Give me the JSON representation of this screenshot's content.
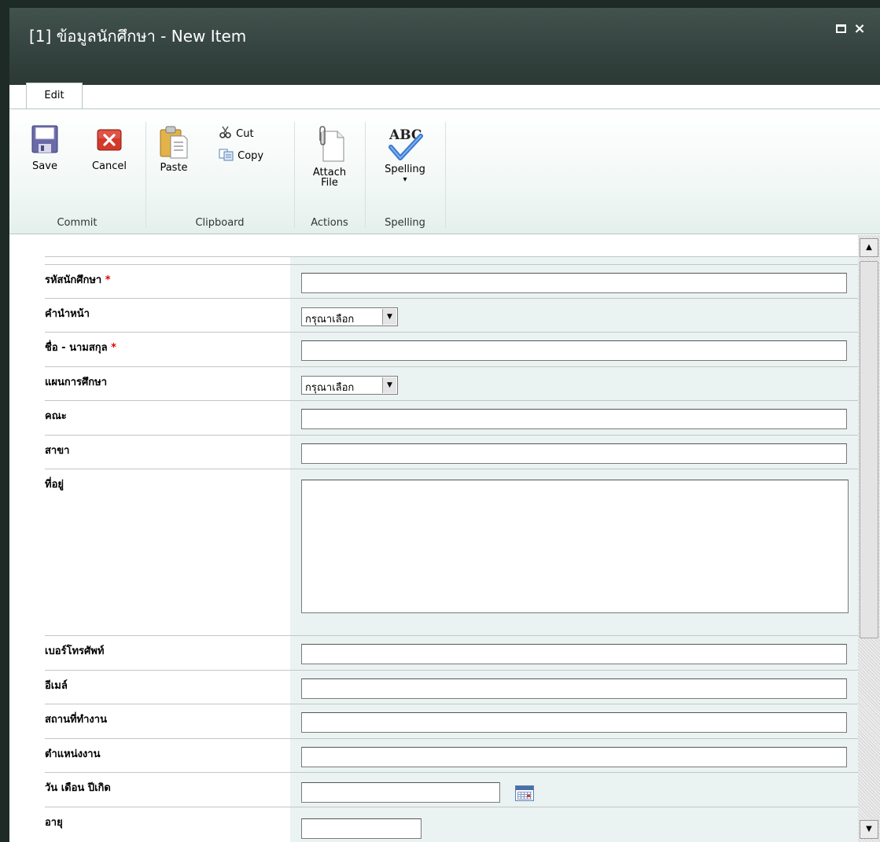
{
  "dialog": {
    "title": "[1] ข้อมูลนักศึกษา - New Item",
    "maximize_icon": "maximize-icon",
    "close_icon": "close-icon",
    "close_glyph": "×"
  },
  "ribbon": {
    "tab": "Edit",
    "groups": {
      "commit": "Commit",
      "clipboard": "Clipboard",
      "actions": "Actions",
      "spelling": "Spelling"
    },
    "buttons": {
      "save": "Save",
      "cancel": "Cancel",
      "paste": "Paste",
      "cut": "Cut",
      "copy": "Copy",
      "attach_line1": "Attach",
      "attach_line2": "File",
      "spelling": "Spelling",
      "spelling_arrow": "▾",
      "abc": "ABC"
    }
  },
  "form": {
    "required_mark": "*",
    "select_arrow": "▼",
    "fields": [
      {
        "label": "รหัสนักศึกษา",
        "required": true,
        "type": "text",
        "value": ""
      },
      {
        "label": "คำนำหน้า",
        "required": false,
        "type": "select",
        "value": "กรุณาเลือก"
      },
      {
        "label": "ชื่อ - นามสกุล",
        "required": true,
        "type": "text",
        "value": ""
      },
      {
        "label": "แผนการศึกษา",
        "required": false,
        "type": "select",
        "value": "กรุณาเลือก"
      },
      {
        "label": "คณะ",
        "required": false,
        "type": "text",
        "value": ""
      },
      {
        "label": "สาขา",
        "required": false,
        "type": "text",
        "value": ""
      },
      {
        "label": "ที่อยู่",
        "required": false,
        "type": "textarea",
        "value": ""
      },
      {
        "label": "เบอร์โทรศัพท์",
        "required": false,
        "type": "text",
        "value": ""
      },
      {
        "label": "อีเมล์",
        "required": false,
        "type": "text",
        "value": ""
      },
      {
        "label": "สถานที่ทำงาน",
        "required": false,
        "type": "text",
        "value": ""
      },
      {
        "label": "ตำแหน่งงาน",
        "required": false,
        "type": "text",
        "value": ""
      },
      {
        "label": "วัน เดือน ปีเกิด",
        "required": false,
        "type": "date",
        "value": ""
      },
      {
        "label": "อายุ",
        "required": false,
        "type": "text",
        "value": ""
      }
    ]
  },
  "scrollbar": {
    "up_glyph": "▲",
    "down_glyph": "▼"
  },
  "colors": {
    "titlebar": "#33423e",
    "field_column": "#eaf3f1",
    "required": "#e00000"
  }
}
